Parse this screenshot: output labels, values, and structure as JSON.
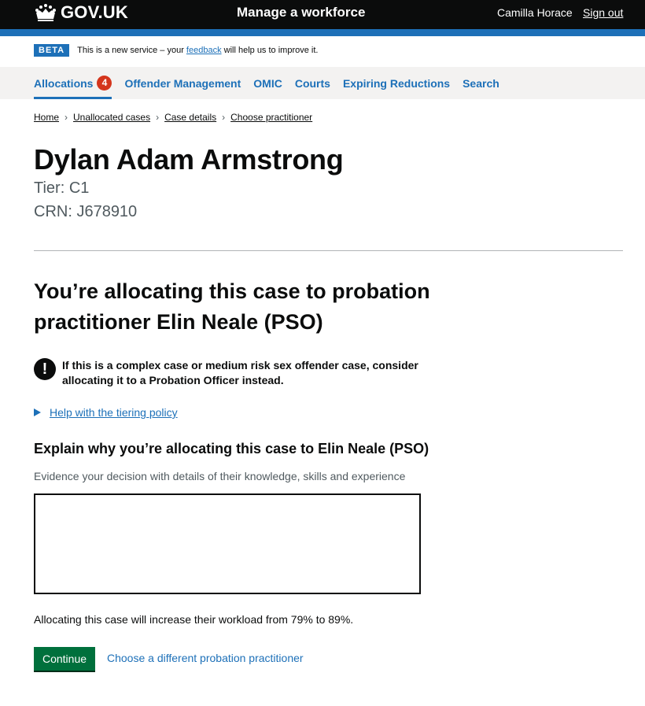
{
  "header": {
    "logo_text": "GOV.UK",
    "service_name": "Manage a workforce",
    "user_name": "Camilla Horace",
    "sign_out": "Sign out"
  },
  "beta": {
    "tag": "BETA",
    "text_before": "This is a new service – your ",
    "link": "feedback",
    "text_after": " will help us to improve it."
  },
  "nav": {
    "items": [
      {
        "label": "Allocations",
        "badge": "4",
        "active": true
      },
      {
        "label": "Offender Management"
      },
      {
        "label": "OMIC"
      },
      {
        "label": "Courts"
      },
      {
        "label": "Expiring Reductions"
      },
      {
        "label": "Search"
      }
    ]
  },
  "breadcrumbs": [
    "Home",
    "Unallocated cases",
    "Case details",
    "Choose practitioner"
  ],
  "case": {
    "name": "Dylan Adam Armstrong",
    "tier": "Tier: C1",
    "crn": "CRN: J678910"
  },
  "section_title": "You’re allocating this case to probation practitioner Elin Neale (PSO)",
  "warning": {
    "icon": "!",
    "text": "If this is a complex case or medium risk sex offender case, consider allocating it to a Probation Officer instead."
  },
  "details_summary": "Help with the tiering policy",
  "form": {
    "label": "Explain why you’re allocating this case to Elin Neale (PSO)",
    "hint": "Evidence your decision with details of their knowledge, skills and experience",
    "value": ""
  },
  "workload_text": "Allocating this case will increase their workload from 79% to 89%.",
  "actions": {
    "continue": "Continue",
    "alternative": "Choose a different probation practitioner"
  },
  "colors": {
    "header_bg": "#0b0c0c",
    "brand_blue": "#1d70b8",
    "link": "#1d70b8",
    "button_green": "#00703c",
    "badge_red": "#d4351c",
    "nav_bg": "#f3f2f1"
  }
}
